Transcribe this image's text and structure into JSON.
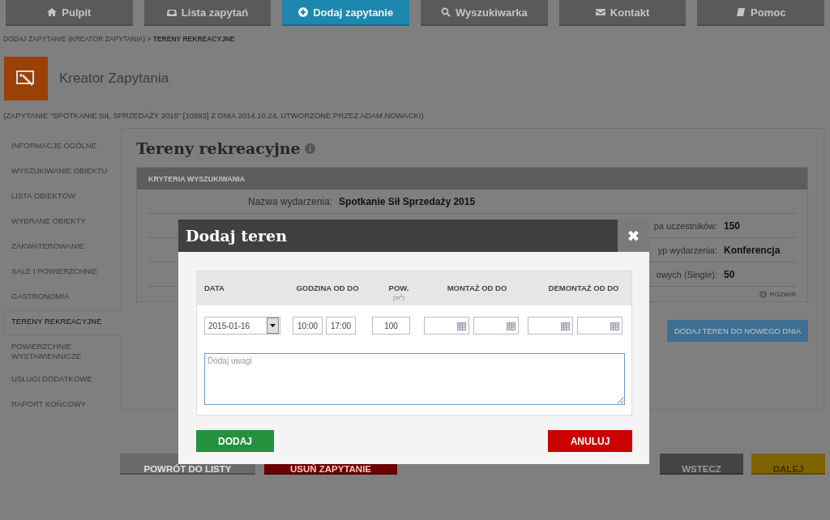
{
  "nav": [
    {
      "label": "Pulpit",
      "selected": false
    },
    {
      "label": "Lista zapytań",
      "selected": false
    },
    {
      "label": "Dodaj zapytanie",
      "selected": true
    },
    {
      "label": "Wyszukiwarka",
      "selected": false
    },
    {
      "label": "Kontakt",
      "selected": false
    },
    {
      "label": "Pomoc",
      "selected": false
    }
  ],
  "breadcrumb": {
    "path": "DODAJ ZAPYTANIE (KREATOR ZAPYTANIA) >",
    "current": "TERENY REKREACYJNE"
  },
  "header": {
    "title": "Kreator Zapytania",
    "info": "(ZAPYTANIE \"SPOTKANIE SIŁ SPRZEDAŻY 2015\" [10893] Z DNIA 2014.10.24, UTWORZONE PRZEZ ADAM NOWACKI)"
  },
  "sidebar": {
    "items": [
      {
        "label": "INFORMACJE OGÓLNE",
        "selected": false
      },
      {
        "label": "WYSZUKIWANIE OBIEKTU",
        "selected": false
      },
      {
        "label": "LISTA OBIEKTÓW",
        "selected": false
      },
      {
        "label": "WYBRANE OBIEKTY",
        "selected": false
      },
      {
        "label": "ZAKWATEROWANIE",
        "selected": false
      },
      {
        "label": "SALE I POWIERZCHNIE",
        "selected": false
      },
      {
        "label": "GASTRONOMIA",
        "selected": false
      },
      {
        "label": "TERENY REKREACYJNE",
        "selected": true
      },
      {
        "label": "POWIERZCHNIE WYSTAWIENNICZE",
        "selected": false
      },
      {
        "label": "USŁUGI DODATKOWE",
        "selected": false
      },
      {
        "label": "RAPORT KOŃCOWY",
        "selected": false
      }
    ]
  },
  "panel": {
    "title": "Tereny rekreacyjne",
    "criteria": {
      "header": "KRYTERIA WYSZUKIWANIA",
      "rows": [
        {
          "kind": "wide",
          "label": "Nazwa wydarzenia:",
          "value": "Spotkanie Sił Sprzedaży 2015"
        },
        {
          "kind": "right",
          "label": "pa uczestników:",
          "value": "150"
        },
        {
          "kind": "right",
          "label": "yp wydarzenia:",
          "value": "Konferencja"
        },
        {
          "kind": "right",
          "label": "owych (Single):",
          "value": "50"
        }
      ],
      "toggle": "ROZWIŃ"
    },
    "add_day_button": "DODAJ TEREN DO NOWEGO DNIA"
  },
  "footer_buttons": [
    {
      "kind": "back-list",
      "label": "POWRÓT DO LISTY"
    },
    {
      "kind": "delete",
      "label": "USUŃ ZAPYTANIE"
    },
    {
      "kind": "prev",
      "label": "WSTECZ"
    },
    {
      "kind": "next",
      "label": "DALEJ"
    }
  ],
  "modal": {
    "title": "Dodaj teren",
    "close": "✖",
    "columns": [
      {
        "label": "DATA"
      },
      {
        "label": "GODZINA OD DO"
      },
      {
        "label": "POW.",
        "unit": "(m$^{2}$)"
      },
      {
        "label": "MONTAŻ OD DO"
      },
      {
        "label": "DEMONTAŻ OD DO"
      }
    ],
    "fields": [
      {
        "kind": "select",
        "value": "2015-01-16"
      },
      {
        "kind": "time",
        "value": "10:00"
      },
      {
        "kind": "time",
        "value": "17:00"
      },
      {
        "kind": "area",
        "value": "100"
      },
      {
        "kind": "date"
      },
      {
        "kind": "date"
      },
      {
        "kind": "date"
      },
      {
        "kind": "date"
      }
    ],
    "notes_placeholder": "Dodaj uwagi",
    "buttons": [
      {
        "kind": "confirm",
        "label": "DODAJ"
      },
      {
        "kind": "cancel",
        "label": "ANULUJ"
      }
    ]
  }
}
